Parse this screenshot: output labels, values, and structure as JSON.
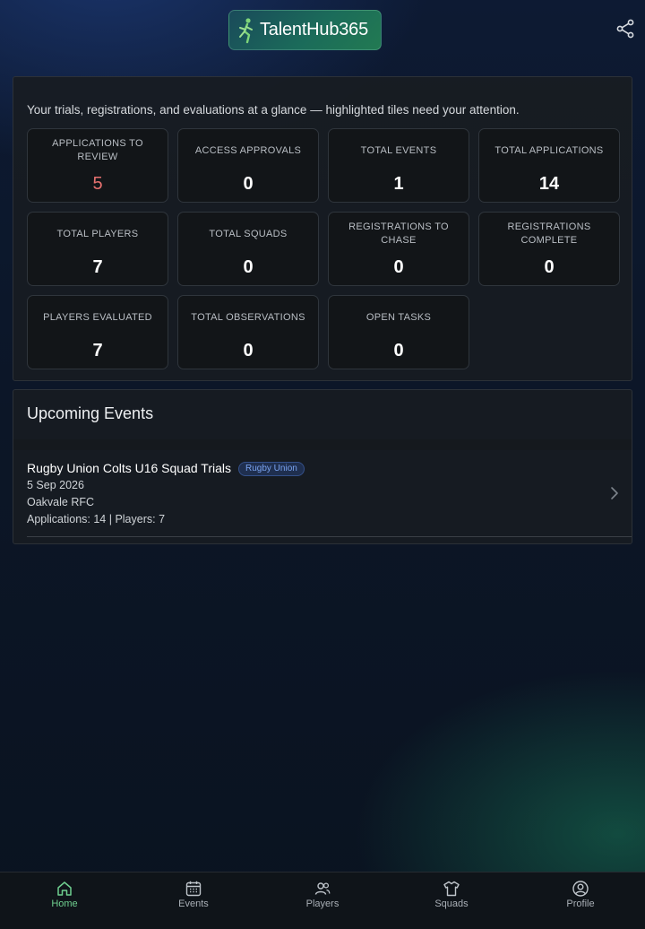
{
  "app": {
    "logo_text": "TalentHub365"
  },
  "intro_text": "Your trials, registrations, and evaluations at a glance — highlighted tiles need your attention.",
  "stats": [
    {
      "label": "APPLICATIONS TO REVIEW",
      "value": "5",
      "highlight": true
    },
    {
      "label": "ACCESS APPROVALS",
      "value": "0"
    },
    {
      "label": "TOTAL EVENTS",
      "value": "1"
    },
    {
      "label": "TOTAL APPLICATIONS",
      "value": "14"
    },
    {
      "label": "TOTAL PLAYERS",
      "value": "7"
    },
    {
      "label": "TOTAL SQUADS",
      "value": "0"
    },
    {
      "label": "REGISTRATIONS TO CHASE",
      "value": "0"
    },
    {
      "label": "REGISTRATIONS COMPLETE",
      "value": "0"
    },
    {
      "label": "PLAYERS EVALUATED",
      "value": "7"
    },
    {
      "label": "TOTAL OBSERVATIONS",
      "value": "0"
    },
    {
      "label": "OPEN TASKS",
      "value": "0"
    }
  ],
  "upcoming": {
    "title": "Upcoming Events",
    "events": [
      {
        "name": "Rugby Union Colts U16 Squad Trials",
        "tag": "Rugby Union",
        "date": "5 Sep 2026",
        "venue": "Oakvale RFC",
        "counts": "Applications: 14 | Players: 7"
      }
    ]
  },
  "nav": [
    {
      "label": "Home",
      "icon": "home-icon",
      "active": true
    },
    {
      "label": "Events",
      "icon": "calendar-icon"
    },
    {
      "label": "Players",
      "icon": "users-icon"
    },
    {
      "label": "Squads",
      "icon": "shirt-icon"
    },
    {
      "label": "Profile",
      "icon": "user-circle-icon"
    }
  ],
  "colors": {
    "accent_green": "#6fcf8f",
    "alert_red": "#e7716f",
    "tag_blue": "#7aa3f0"
  }
}
